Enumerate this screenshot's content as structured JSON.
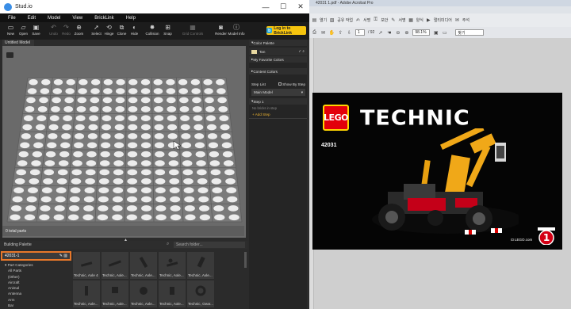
{
  "studio": {
    "title": "Stud.io",
    "window_buttons": {
      "minimize": "—",
      "maximize": "☐",
      "close": "✕"
    },
    "menu": [
      "File",
      "Edit",
      "Model",
      "View",
      "BrickLink",
      "Help"
    ],
    "toolbar": [
      {
        "label": "New",
        "icon": "new-file-icon",
        "enabled": true
      },
      {
        "label": "Open",
        "icon": "open-folder-icon",
        "enabled": true
      },
      {
        "label": "Save",
        "icon": "save-icon",
        "enabled": true
      },
      {
        "label": "Undo",
        "icon": "undo-icon",
        "enabled": false
      },
      {
        "label": "Redo",
        "icon": "redo-icon",
        "enabled": false
      },
      {
        "label": "Zoom",
        "icon": "zoom-icon",
        "enabled": true
      },
      {
        "label": "Select",
        "icon": "select-cursor-icon",
        "enabled": true
      },
      {
        "label": "Hinge",
        "icon": "hinge-icon",
        "enabled": true
      },
      {
        "label": "Clone",
        "icon": "clone-icon",
        "enabled": true
      },
      {
        "label": "Hide",
        "icon": "hide-icon",
        "enabled": true
      },
      {
        "label": "Collision",
        "icon": "collision-icon",
        "enabled": true
      },
      {
        "label": "Snap",
        "icon": "snap-icon",
        "enabled": true
      },
      {
        "label": "Grid Controls",
        "icon": "grid-icon",
        "enabled": false
      },
      {
        "label": "Render",
        "icon": "camera-icon",
        "enabled": true
      },
      {
        "label": "Model Info",
        "icon": "info-icon",
        "enabled": true
      }
    ],
    "bricklink_button": "Log in to BrickLink",
    "model_tab": "Untitled Model",
    "status": "0 total parts",
    "building_palette": {
      "title": "Building Palette",
      "search_placeholder": "Search folder...",
      "selected_set": "42031-1",
      "categories_header": "Part Categories",
      "categories": [
        "All Parts",
        "(Other)",
        "Aircraft",
        "Animal",
        "Antenna",
        "Arm",
        "Bar"
      ],
      "parts": [
        "Technic, Axle 4",
        "Technic, Axle...",
        "Technic, Axle...",
        "Technic, Axle...",
        "Technic, Axle...",
        "Technic, Axle...",
        "Technic, Axle...",
        "Technic, Axle...",
        "Technic, Axle...",
        "Technic, Gear..."
      ]
    },
    "right_panel": {
      "color_palette": "Color Palette",
      "selected_color": "Tan",
      "selected_color_hex": "#e8d8a0",
      "my_favorite_colors": "My Favorite Colors",
      "content_colors": "Content Colors",
      "step_list": "Step List",
      "show_by_step": "Show By Step",
      "main_model": "Main Model",
      "step1": "Step 1",
      "no_bricks": "No bricks in step",
      "add_step": "+ Add Step"
    }
  },
  "acrobat": {
    "title": "42031 1.pdf - Adobe Acrobat Pro",
    "toolbar1": [
      "열기",
      "공유 작업",
      "서명",
      "보안",
      "서명",
      "양식",
      "멀티미디어",
      "주석"
    ],
    "page_current": "1",
    "page_total": "/ 92",
    "zoom": "98.1%",
    "find": "찾기",
    "pdf": {
      "brand": "LEGO",
      "title": "TECHNIC",
      "set_number": "42031",
      "website": "LEGO.com",
      "page_badge": "1"
    }
  }
}
